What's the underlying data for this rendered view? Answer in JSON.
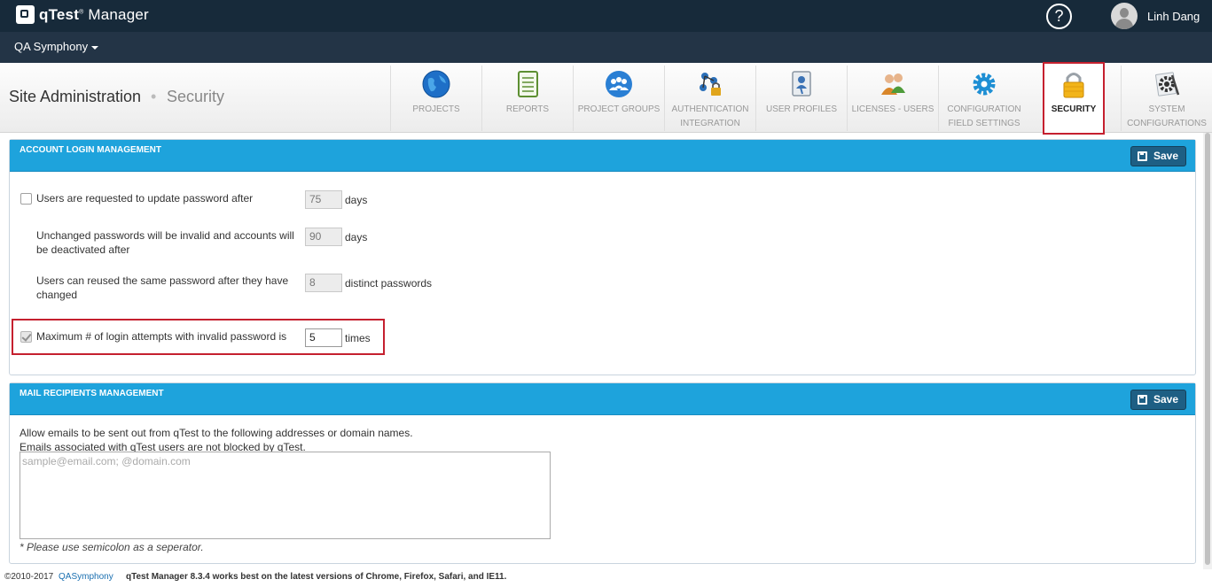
{
  "header": {
    "app_name_bold": "qTest",
    "app_name_rest": "Manager",
    "help_symbol": "?",
    "user_name": "Linh Dang"
  },
  "project": {
    "selected": "QA Symphony"
  },
  "breadcrumb": {
    "section": "Site Administration",
    "separator": "•",
    "page": "Security"
  },
  "nav_tabs": [
    {
      "line1": "PROJECTS",
      "line2": "",
      "icon": "globe-icon"
    },
    {
      "line1": "REPORTS",
      "line2": "",
      "icon": "notebook-icon"
    },
    {
      "line1": "PROJECT GROUPS",
      "line2": "",
      "icon": "people-group-icon"
    },
    {
      "line1": "AUTHENTICATION",
      "line2": "INTEGRATION",
      "icon": "network-lock-icon"
    },
    {
      "line1": "USER PROFILES",
      "line2": "",
      "icon": "id-badge-icon"
    },
    {
      "line1": "LICENSES - USERS",
      "line2": "",
      "icon": "users-icon"
    },
    {
      "line1": "CONFIGURATION",
      "line2": "FIELD SETTINGS",
      "icon": "gear-icon"
    },
    {
      "line1": "SECURITY",
      "line2": "",
      "icon": "padlock-icon"
    },
    {
      "line1": "SYSTEM",
      "line2": "CONFIGURATIONS",
      "icon": "tools-gear-icon"
    }
  ],
  "account_panel": {
    "title": "ACCOUNT LOGIN MANAGEMENT",
    "save_label": "Save",
    "rows": [
      {
        "label": "Users are requested to update password after",
        "value": "75",
        "unit": "days"
      },
      {
        "label_line1": "Unchanged passwords will be invalid and accounts will",
        "label_line2": "be deactivated after",
        "value": "90",
        "unit": "days"
      },
      {
        "label_line1": "Users can reused the same password after they have",
        "label_line2": "changed",
        "value": "8",
        "unit": "distinct passwords"
      },
      {
        "label": "Maximum # of login attempts with invalid password is",
        "value": "5",
        "unit": "times"
      }
    ]
  },
  "mail_panel": {
    "title": "MAIL RECIPIENTS MANAGEMENT",
    "save_label": "Save",
    "desc_line1": "Allow emails to be sent out from qTest to the following addresses or domain names.",
    "desc_line2": "Emails associated with qTest users are not blocked by qTest.",
    "placeholder": "sample@email.com; @domain.com",
    "note": "* Please use semicolon as a seperator."
  },
  "footer": {
    "copyright": "©2010-2017",
    "company_link": "QASymphony",
    "message": "qTest Manager 8.3.4 works best on the latest versions of Chrome, Firefox, Safari, and IE11."
  }
}
